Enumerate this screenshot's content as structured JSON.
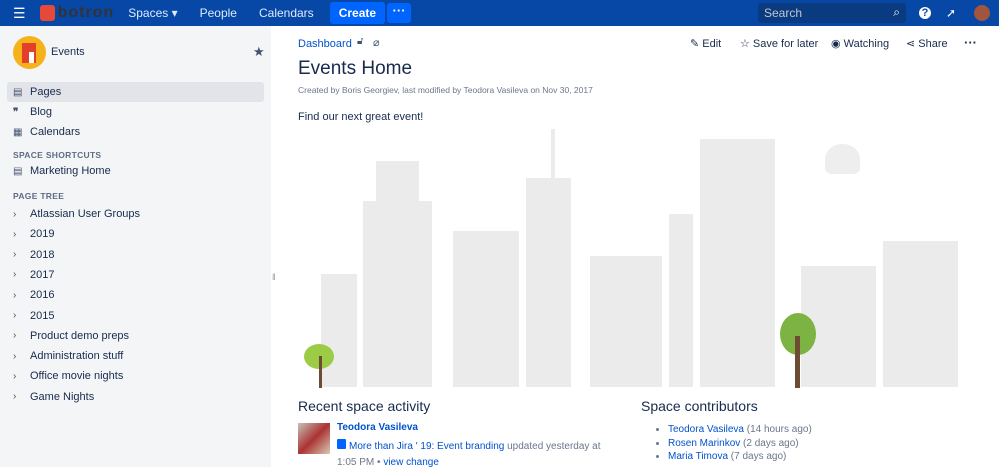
{
  "topbar": {
    "logo": "botron",
    "nav": [
      "Spaces",
      "People",
      "Calendars"
    ],
    "create": "Create",
    "more": "···",
    "search_placeholder": "Search"
  },
  "sidebar": {
    "space_name": "Events",
    "items": [
      {
        "label": "Pages",
        "icon": "page-icon"
      },
      {
        "label": "Blog",
        "icon": "quote-icon"
      },
      {
        "label": "Calendars",
        "icon": "calendar-icon"
      }
    ],
    "shortcuts_heading": "SPACE SHORTCUTS",
    "shortcuts": [
      "Marketing Home"
    ],
    "tree_heading": "PAGE TREE",
    "tree": [
      "Atlassian User Groups",
      "2019",
      "2018",
      "2017",
      "2016",
      "2015",
      "Product demo preps",
      "Administration stuff",
      "Office movie nights",
      "Game Nights"
    ]
  },
  "page": {
    "breadcrumb": "Dashboard",
    "actions": {
      "edit": "Edit",
      "save": "Save for later",
      "watch": "Watching",
      "share": "Share",
      "more": "···"
    },
    "title": "Events Home",
    "byline": "Created by Boris Georgiev, last modified by Teodora Vasileva on Nov 30, 2017",
    "intro": "Find our next great event!"
  },
  "activity": {
    "heading": "Recent space activity",
    "user": "Teodora Vasileva",
    "page_link": "More than Jira ' 19: Event branding",
    "updated": "updated yesterday at",
    "time": "1:05 PM",
    "sep": "•",
    "view_change": "view change"
  },
  "contributors": {
    "heading": "Space contributors",
    "list": [
      {
        "name": "Teodora Vasileva",
        "when": "(14 hours ago)"
      },
      {
        "name": "Rosen Marinkov",
        "when": "(2 days ago)"
      },
      {
        "name": "Maria Timova",
        "when": "(7 days ago)"
      }
    ]
  }
}
